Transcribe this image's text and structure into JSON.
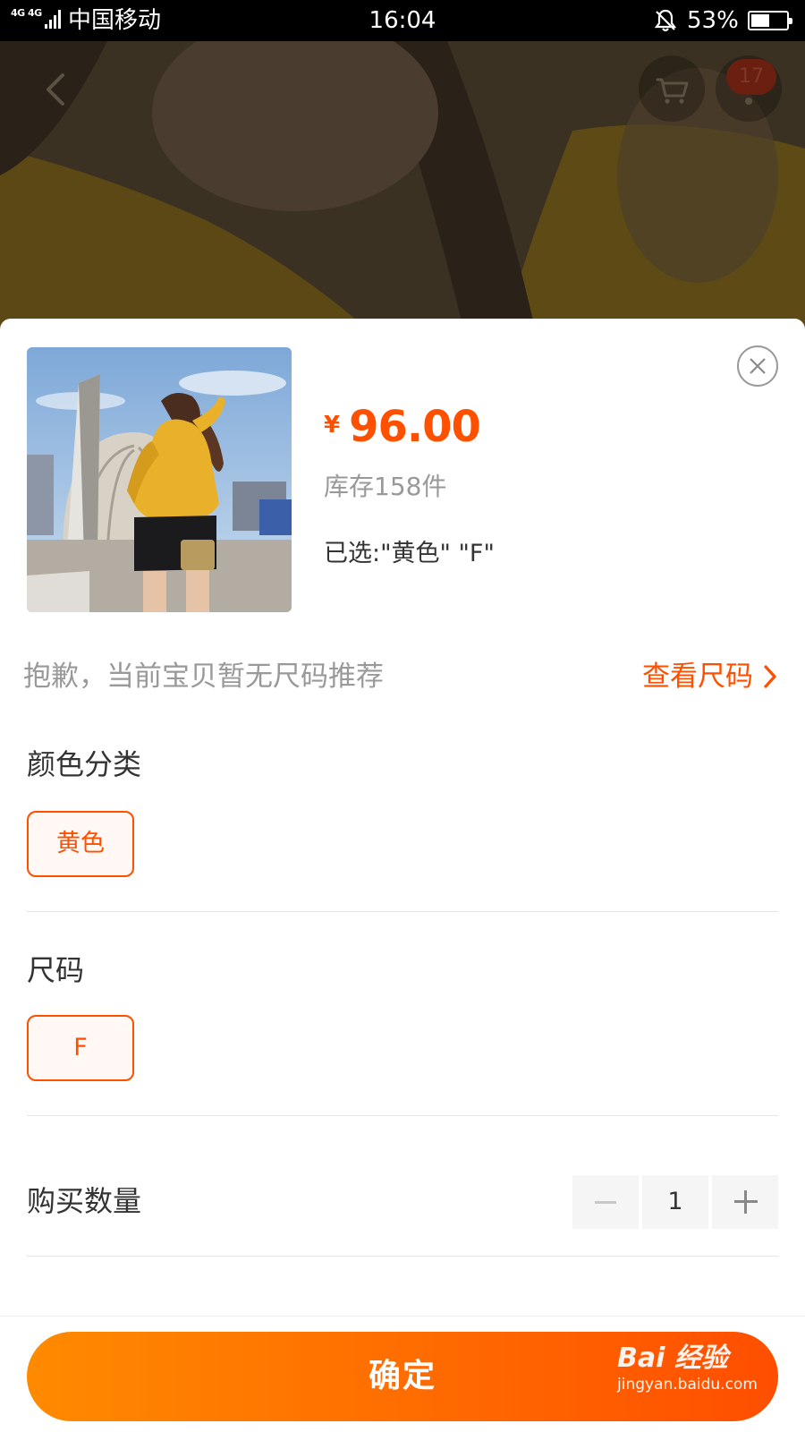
{
  "status_bar": {
    "network": "4G 4G",
    "carrier": "中国移动",
    "time": "16:04",
    "battery_percent": "53%",
    "battery_level": 0.53
  },
  "top_nav": {
    "back_icon": "chevron-left-icon",
    "cart_icon": "cart-icon",
    "more_icon": "more-icon",
    "badge_count": "17"
  },
  "sheet": {
    "price": {
      "currency": "¥",
      "amount": "96.00"
    },
    "stock": "库存158件",
    "selected": "已选:\"黄色\" \"F\"",
    "size_note": "抱歉，当前宝贝暂无尺码推荐",
    "size_link": "查看尺码",
    "color_section": {
      "label": "颜色分类",
      "options": [
        "黄色"
      ]
    },
    "size_section": {
      "label": "尺码",
      "options": [
        "F"
      ]
    },
    "quantity": {
      "label": "购买数量",
      "value": "1"
    },
    "confirm_label": "确定"
  },
  "watermark": {
    "logo": "Bai 经验",
    "url": "jingyan.baidu.com"
  },
  "colors": {
    "accent": "#ff5000",
    "button_gradient_start": "#ff8a00",
    "button_gradient_end": "#ff4e00",
    "chip_background": "#fff8f4"
  }
}
